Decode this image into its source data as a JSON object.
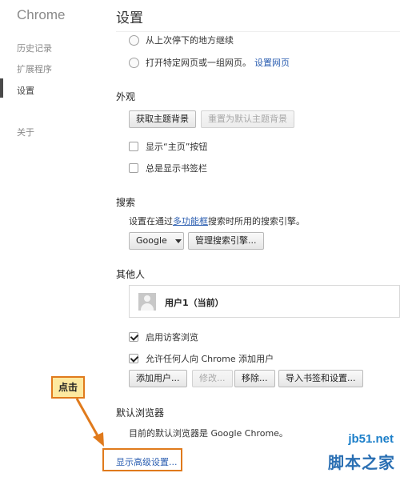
{
  "sidebar": {
    "brand": "Chrome",
    "items": [
      {
        "label": "历史记录"
      },
      {
        "label": "扩展程序"
      },
      {
        "label": "设置"
      },
      {
        "label": "关于"
      }
    ]
  },
  "header": {
    "title": "设置"
  },
  "startup": {
    "continue_label": "从上次停下的地方继续",
    "open_pages_label": "打开特定网页或一组网页。",
    "set_pages_link": "设置网页"
  },
  "appearance": {
    "heading": "外观",
    "get_themes_label": "获取主题背景",
    "reset_theme_label": "重置为默认主题背景",
    "show_home_label": "显示“主页”按钮",
    "show_bookmarks_label": "总是显示书签栏"
  },
  "search": {
    "heading": "搜索",
    "desc_prefix": "设置在通过",
    "desc_link": "多功能框",
    "desc_suffix": "搜索时所用的搜索引擎。",
    "engine_value": "Google",
    "manage_label": "管理搜索引擎..."
  },
  "people": {
    "heading": "其他人",
    "profile_name": "用户1（当前）",
    "guest_label": "启用访客浏览",
    "allow_add_label": "允许任何人向 Chrome 添加用户",
    "add_user_label": "添加用户...",
    "edit_label": "修改...",
    "remove_label": "移除...",
    "import_label": "导入书签和设置..."
  },
  "default_browser": {
    "heading": "默认浏览器",
    "desc": "目前的默认浏览器是 Google Chrome。"
  },
  "advanced_link": "显示高级设置...",
  "annotation": {
    "callout_text": "点击",
    "color": "#e07a1c"
  },
  "watermark": {
    "site": "jb51.net",
    "name": "脚本之家"
  }
}
